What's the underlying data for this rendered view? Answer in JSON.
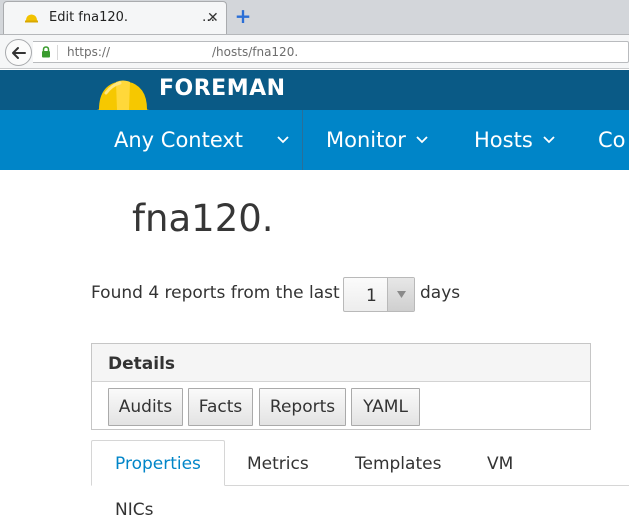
{
  "browser": {
    "tab_title": "Edit fna120.",
    "tab_ellipsis": "…",
    "tab_close": "✕",
    "new_tab": "+",
    "url_scheme": "https://",
    "url_path": "/hosts/fna120."
  },
  "header": {
    "brand": "FOREMAN",
    "colors": {
      "brandbar": "#0a5a86",
      "menubar": "#0085c8"
    }
  },
  "menu": {
    "context": "Any Context",
    "monitor": "Monitor",
    "hosts": "Hosts",
    "configure_partial": "Co"
  },
  "page": {
    "host_title": "fna120.",
    "reports_prefix": "Found 4 reports from the last",
    "days_value": "1",
    "reports_suffix": "days"
  },
  "details": {
    "title": "Details",
    "buttons": [
      "Audits",
      "Facts",
      "Reports",
      "YAML"
    ]
  },
  "tabs": {
    "active": "Properties",
    "items": [
      "Properties",
      "Metrics",
      "Templates",
      "VM",
      "NICs"
    ],
    "active_color": "#0085c8"
  }
}
